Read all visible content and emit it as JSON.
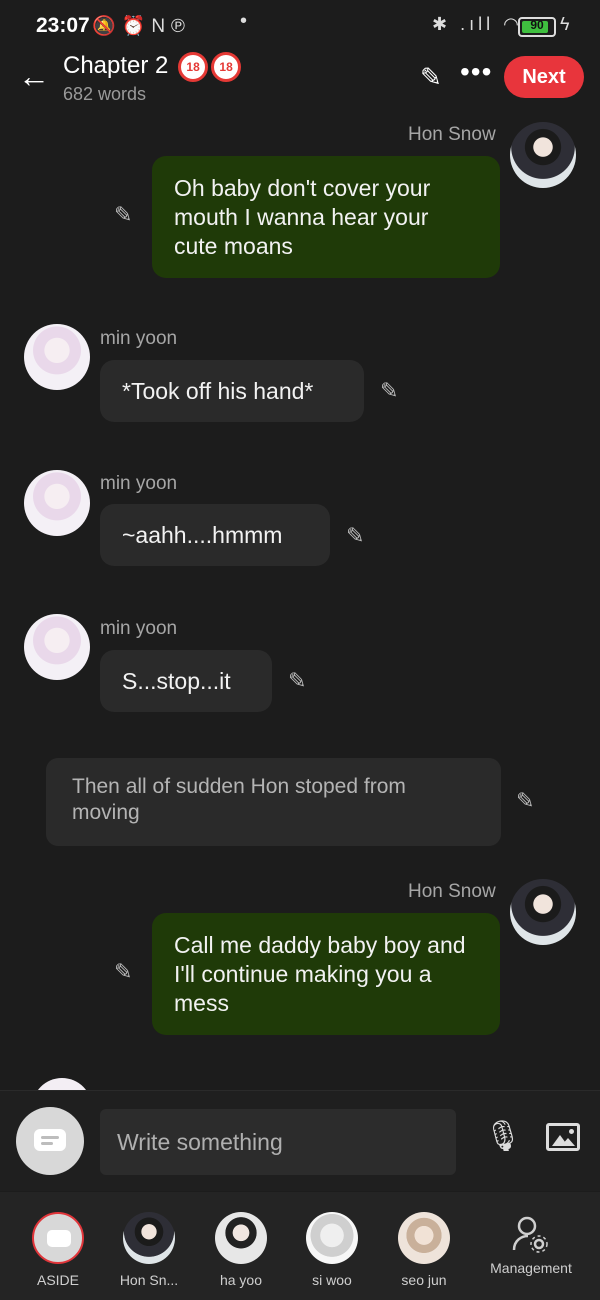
{
  "status_bar": {
    "time": "23:07",
    "left_icons": "🔕⏰N℗",
    "dot": "•",
    "right_icons": "✱ .ıll ◠",
    "battery": "90",
    "bolt": "ϟ"
  },
  "header": {
    "back_icon": "←",
    "title": "Chapter 2",
    "badges": [
      "18",
      "18"
    ],
    "word_count": "682 words",
    "edit_icon": "✎",
    "more_icon": "•••",
    "next_label": "Next"
  },
  "messages": [
    {
      "sender": "Hon Snow",
      "text": "Oh baby don't cover your mouth I wanna hear your cute moans"
    },
    {
      "sender": "min yoon",
      "text": "*Took off his hand*"
    },
    {
      "sender": "min yoon",
      "text": "~aahh....hmmm"
    },
    {
      "sender": "min yoon",
      "text": "S...stop...it"
    },
    {
      "sender": "",
      "text": "Then all of sudden Hon stoped from moving"
    },
    {
      "sender": "Hon Snow",
      "text": "Call me daddy baby boy and I'll continue making you a mess"
    }
  ],
  "composer": {
    "placeholder": "Write something",
    "mic_icon": "🎙"
  },
  "nav": [
    {
      "label": "ASIDE"
    },
    {
      "label": "Hon Sn..."
    },
    {
      "label": "ha yoo"
    },
    {
      "label": "si woo"
    },
    {
      "label": "seo jun"
    },
    {
      "label": "Management"
    }
  ],
  "colors": {
    "background": "#1c1c1c",
    "my_bubble": "#1f3a08",
    "their_bubble": "#2a2a2a",
    "accent": "#e8353c"
  }
}
